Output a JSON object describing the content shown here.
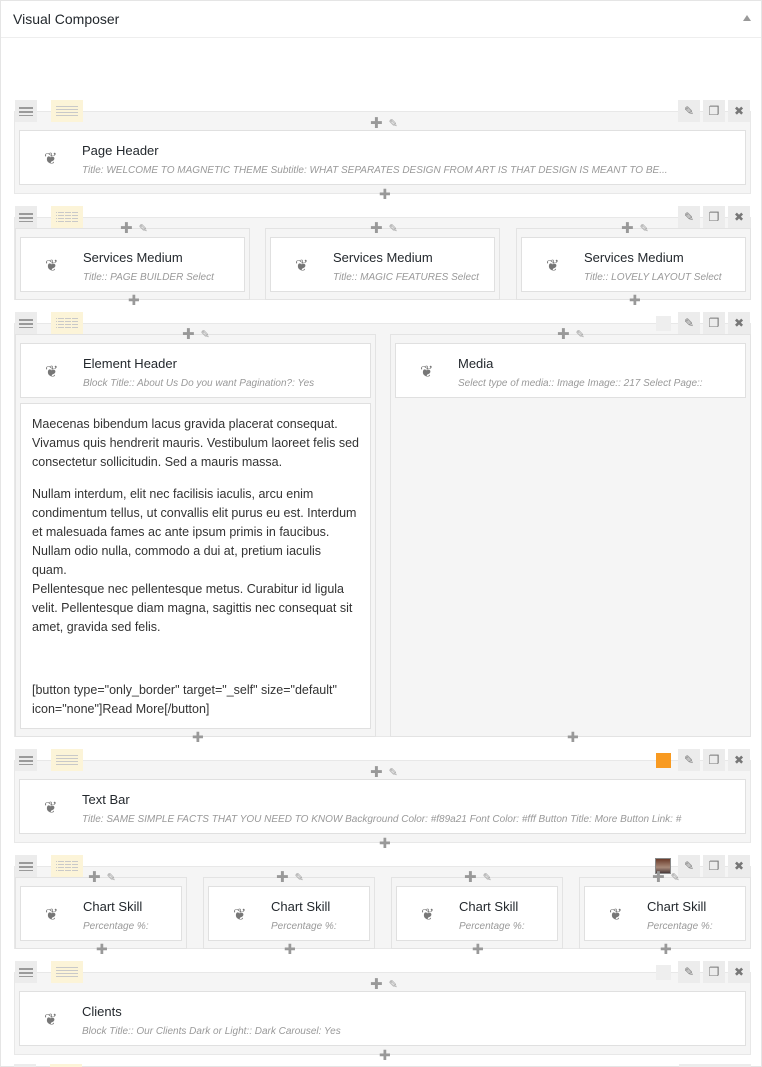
{
  "panel": {
    "title": "Visual Composer"
  },
  "icons": {
    "element": "vc-element-icon",
    "drag": "drag-handle-icon",
    "layout": "row-layout-icon",
    "edit": "pencil-icon",
    "clone": "clone-icon",
    "delete": "close-icon",
    "add": "plus-icon",
    "collapse": "triangle-up-icon"
  },
  "colors": {
    "textbar_swatch": "#f89a21",
    "swatch_empty": "#eeeeee"
  },
  "rows": {
    "r1": {
      "el": {
        "title": "Page Header",
        "desc": "Title: WELCOME TO MAGNETIC THEME  Subtitle: WHAT SEPARATES DESIGN FROM ART IS THAT DESIGN IS MEANT TO BE..."
      }
    },
    "r2": {
      "cols": [
        {
          "title": "Services Medium",
          "desc": "Title:: PAGE BUILDER  Select"
        },
        {
          "title": "Services Medium",
          "desc": "Title:: MAGIC FEATURES  Select"
        },
        {
          "title": "Services Medium",
          "desc": "Title:: LOVELY LAYOUT  Select"
        }
      ]
    },
    "r3": {
      "left": {
        "title": "Element Header",
        "desc": "Block Title:: About Us  Do you want Pagination?: Yes"
      },
      "text": {
        "p1": "Maecenas bibendum lacus gravida placerat consequat. Vivamus quis hendrerit mauris. Vestibulum laoreet felis sed consectetur sollicitudin. Sed a mauris massa.",
        "p2a": "Nullam interdum, elit nec facilisis iaculis, arcu enim condimentum tellus, ut convallis elit purus eu est. Interdum et malesuada fames ac ante ipsum primis in faucibus. Nullam odio nulla, commodo a dui at, pretium iaculis quam.",
        "p2b": "Pellentesque nec pellentesque metus. Curabitur id ligula velit. Pellentesque diam magna, sagittis nec consequat sit amet, gravida sed felis.",
        "p3": "[button type=\"only_border\" target=\"_self\" size=\"default\" icon=\"none\"]Read More[/button]"
      },
      "right": {
        "title": "Media",
        "desc": "Select type of media:: Image  Image:: 217  Select Page::"
      }
    },
    "r4": {
      "el": {
        "title": "Text Bar",
        "desc": "Title: SAME SIMPLE FACTS THAT YOU NEED TO KNOW  Background Color: #f89a21  Font Color: #fff  Button Title: More  Button Link: #"
      }
    },
    "r5": {
      "cols": [
        {
          "title": "Chart Skill",
          "desc": "Percentage %:"
        },
        {
          "title": "Chart Skill",
          "desc": "Percentage %:"
        },
        {
          "title": "Chart Skill",
          "desc": "Percentage %:"
        },
        {
          "title": "Chart Skill",
          "desc": "Percentage %:"
        }
      ]
    },
    "r6": {
      "el": {
        "title": "Clients",
        "desc": "Block Title:: Our Clients  Dark or Light:: Dark  Carousel: Yes"
      }
    }
  }
}
